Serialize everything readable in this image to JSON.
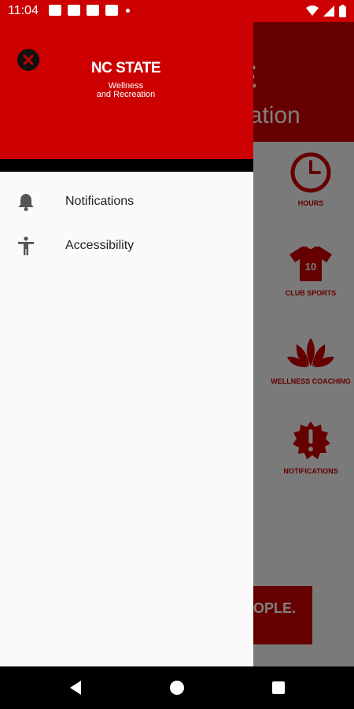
{
  "status_bar": {
    "time": "11:04"
  },
  "background_screen": {
    "hero_title_partial": "E",
    "hero_subtitle_partial": "eation",
    "tiles": [
      {
        "label": "HOURS",
        "icon": "clock-icon"
      },
      {
        "label": "CLUB SPORTS",
        "icon": "jersey-icon"
      },
      {
        "label": "WELLNESS COACHING",
        "icon": "lotus-icon"
      },
      {
        "label": "NOTIFICATIONS",
        "icon": "alert-badge-icon"
      }
    ],
    "banner_text_partial": "OPLE."
  },
  "drawer": {
    "logo": {
      "title": "NC STATE",
      "subtitle_line1": "Wellness",
      "subtitle_line2": "and Recreation"
    },
    "menu_items": [
      {
        "label": "Notifications",
        "icon": "bell-icon"
      },
      {
        "label": "Accessibility",
        "icon": "accessibility-icon"
      }
    ]
  },
  "colors": {
    "brand_red": "#cc0000",
    "drawer_bg": "#fafafa",
    "text_dark": "#212121",
    "icon_gray": "#555555"
  }
}
